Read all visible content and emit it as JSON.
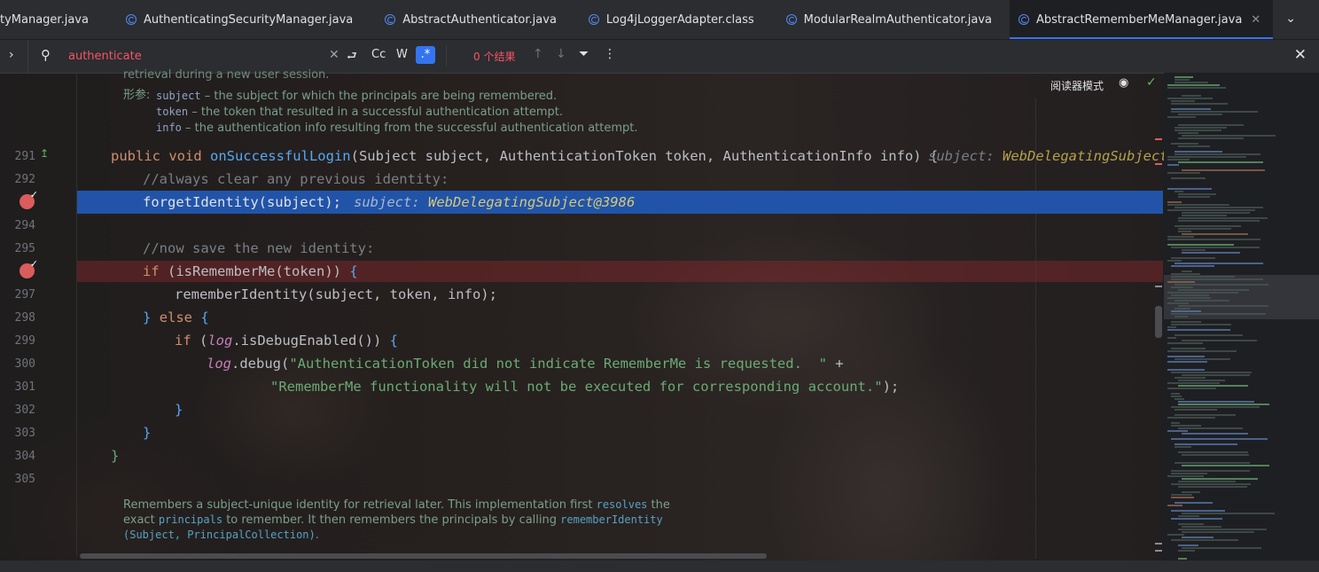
{
  "tabs": [
    {
      "label": "tyManager.java",
      "active": false,
      "closable": false
    },
    {
      "label": "AuthenticatingSecurityManager.java",
      "active": false,
      "closable": false
    },
    {
      "label": "AbstractAuthenticator.java",
      "active": false,
      "closable": false
    },
    {
      "label": "Log4jLoggerAdapter.class",
      "active": false,
      "closable": false
    },
    {
      "label": "ModularRealmAuthenticator.java",
      "active": false,
      "closable": false
    },
    {
      "label": "AbstractRememberMeManager.java",
      "active": true,
      "closable": true
    }
  ],
  "search": {
    "query": "authenticate",
    "match_case_label": "Cc",
    "words_label": "W",
    "regex_label": ".*",
    "results_label": "0 个结果"
  },
  "editor": {
    "reader_mode_label": "阅读器模式",
    "javadoc_top": {
      "cut_line": "retrieval during a new user session.",
      "params_label": "形参:",
      "params": [
        {
          "name": "subject",
          "desc": " – the subject for which the principals are being remembered."
        },
        {
          "name": "token",
          "desc": " – the token that resulted in a successful authentication attempt."
        },
        {
          "name": "info",
          "desc": " – the authentication info resulting from the successful authentication attempt."
        }
      ]
    },
    "line_numbers": [
      "291",
      "292",
      "",
      "294",
      "295",
      "",
      "297",
      "298",
      "299",
      "300",
      "301",
      "302",
      "303",
      "304",
      "305"
    ],
    "code": {
      "l291_sig": "public void onSuccessfulLogin(Subject subject, AuthenticationToken token, AuthenticationInfo info) {",
      "l291_hint_label": "subject:",
      "l291_hint_value": "WebDelegatingSubject@",
      "l292": "//always clear any previous identity:",
      "l293": "forgetIdentity(subject);",
      "l293_hint_label": "subject:",
      "l293_hint_value": "WebDelegatingSubject@3986",
      "l295": "//now save the new identity:",
      "l296": "if (isRememberMe(token)) {",
      "l297": "rememberIdentity(subject, token, info);",
      "l298": "} else {",
      "l299": "if (log.isDebugEnabled()) {",
      "l300_a": "log.debug(",
      "l300_str": "\"AuthenticationToken did not indicate RememberMe is requested.  \"",
      "l300_b": " +",
      "l301_str": "\"RememberMe functionality will not be executed for corresponding account.\"",
      "l301_b": ");",
      "l302": "}",
      "l303": "}",
      "l304": "}"
    },
    "javadoc_bottom": {
      "line1_a": "Remembers a subject-unique identity for retrieval later. This implementation first ",
      "line1_link": "resolves",
      "line1_b": " the",
      "line2_a": "exact ",
      "line2_link": "principals",
      "line2_b": " to remember. It then remembers the principals by calling ",
      "line2_link2": "rememberIdentity",
      "line3": "(Subject, PrincipalCollection)",
      "line3_end": "."
    }
  },
  "colors": {
    "accent": "#3574f0",
    "exec_line": "#2154a8",
    "breakpoint": "#db5c5c",
    "search_text": "#f75464"
  }
}
